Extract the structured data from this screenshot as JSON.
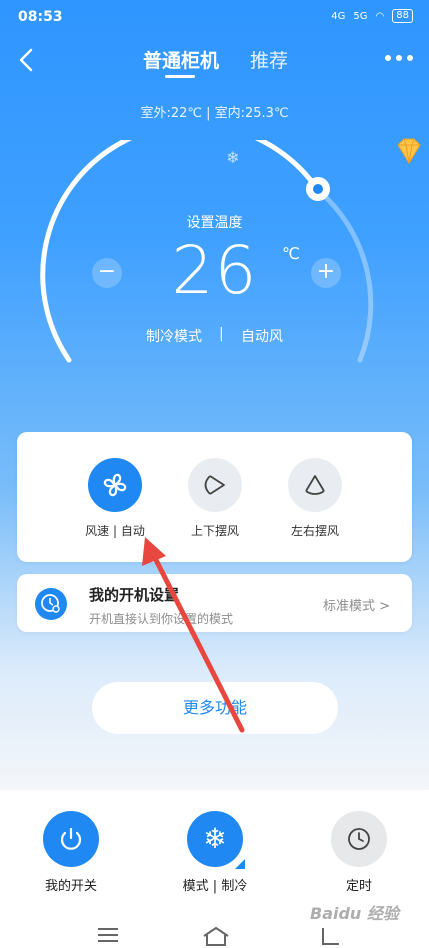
{
  "status": {
    "time": "08:53",
    "signal1": "4G",
    "signal2": "5G",
    "battery": "88"
  },
  "nav": {
    "tab_active": "普通柜机",
    "tab_inactive": "推荐"
  },
  "temps": "室外:22℃ | 室内:25.3℃",
  "dial": {
    "set_label": "设置温度",
    "temperature": "26",
    "unit": "℃",
    "minus": "−",
    "plus": "+",
    "mode": "制冷模式",
    "separator": "|",
    "wind": "自动风"
  },
  "wind_controls": [
    {
      "label": "风速 | 自动",
      "icon": "fan-icon",
      "active": true
    },
    {
      "label": "上下摆风",
      "icon": "vertical-swing-icon",
      "active": false
    },
    {
      "label": "左右摆风",
      "icon": "horizontal-swing-icon",
      "active": false
    }
  ],
  "power_setting": {
    "title": "我的开机设置",
    "subtitle": "开机直接认到你设置的模式",
    "mode": "标准模式 >"
  },
  "more_button": "更多功能",
  "bottom_controls": [
    {
      "label": "我的开关",
      "icon": "power-icon"
    },
    {
      "label": "模式 | 制冷",
      "icon": "snowflake-icon"
    },
    {
      "label": "定时",
      "icon": "clock-icon"
    }
  ],
  "watermark": "Baidu 经验",
  "colors": {
    "accent": "#1f88f2",
    "annotation": "#e8473f"
  }
}
